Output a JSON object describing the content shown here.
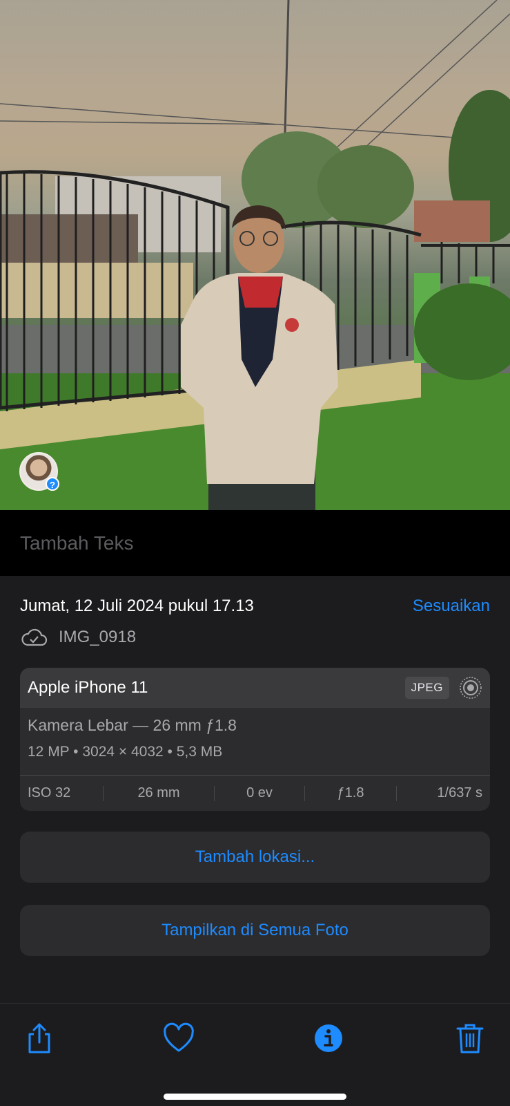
{
  "photo": {
    "people_badge_label": "?"
  },
  "caption": {
    "placeholder": "Tambah Teks"
  },
  "info": {
    "date": "Jumat, 12 Juli 2024 pukul 17.13",
    "adjust_label": "Sesuaikan",
    "filename": "IMG_0918",
    "cloud_icon": "cloud-check-icon"
  },
  "camera_card": {
    "device": "Apple iPhone 11",
    "format_badge": "JPEG",
    "live_icon": "live-photo-icon",
    "lens": "Kamera Lebar — 26 mm ƒ1.8",
    "specs": "12 MP  •  3024 × 4032  •  5,3 MB",
    "exif": {
      "iso": "ISO 32",
      "focal": "26 mm",
      "ev": "0 ev",
      "aperture": "ƒ1.8",
      "shutter": "1/637 s"
    }
  },
  "buttons": {
    "add_location": "Tambah lokasi...",
    "show_all_photos": "Tampilkan di Semua Foto"
  },
  "toolbar": {
    "share_icon": "share-icon",
    "favorite_icon": "heart-icon",
    "info_icon": "info-icon",
    "delete_icon": "trash-icon"
  },
  "colors": {
    "accent": "#1e8bff",
    "panel_bg": "#1c1c1e",
    "card_bg": "#2c2c2e",
    "secondary_text": "#a9a9ad"
  }
}
